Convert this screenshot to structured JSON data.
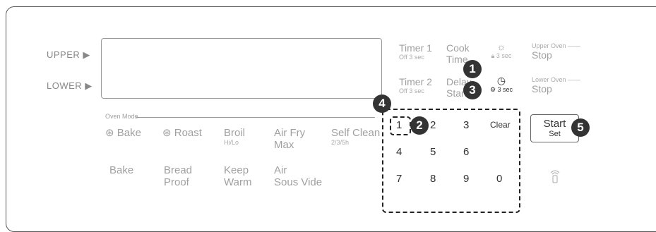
{
  "side": {
    "upper": "UPPER ▶",
    "lower": "LOWER ▶"
  },
  "oven_mode": {
    "title": "Oven Mode",
    "row1": [
      {
        "label": "Bake",
        "icon": "fan-icon"
      },
      {
        "label": "Roast",
        "icon": "fan-icon"
      },
      {
        "label": "Broil",
        "sub": "Hi/Lo"
      },
      {
        "label": "Air Fry",
        "label2": "Max"
      },
      {
        "label": "Self Clean",
        "sub": "2/3/5h"
      }
    ],
    "row2": [
      {
        "label": "Bake"
      },
      {
        "label": "Bread",
        "label2": "Proof"
      },
      {
        "label": "Keep",
        "label2": "Warm"
      },
      {
        "label": "Air",
        "label2": "Sous Vide"
      }
    ]
  },
  "timers": {
    "timer1": "Timer 1",
    "timer1_sub": "Off 3 sec",
    "cook": "Cook",
    "cook2": "Time",
    "light_sub": "3 sec",
    "upper_oven": "Upper Oven",
    "upper_stop": "Stop",
    "timer2": "Timer 2",
    "timer2_sub": "Off 3 sec",
    "delay": "Delay",
    "delay2": "Start",
    "clock_sub": "3 sec",
    "lower_oven": "Lower Oven",
    "lower_stop": "Stop"
  },
  "keypad": {
    "keys": [
      "1",
      "2",
      "3",
      "Clear",
      "4",
      "5",
      "6",
      "7",
      "8",
      "9",
      "0"
    ]
  },
  "start": {
    "label": "Start",
    "sub": "Set"
  },
  "callouts": [
    "1",
    "2",
    "3",
    "4",
    "5"
  ]
}
